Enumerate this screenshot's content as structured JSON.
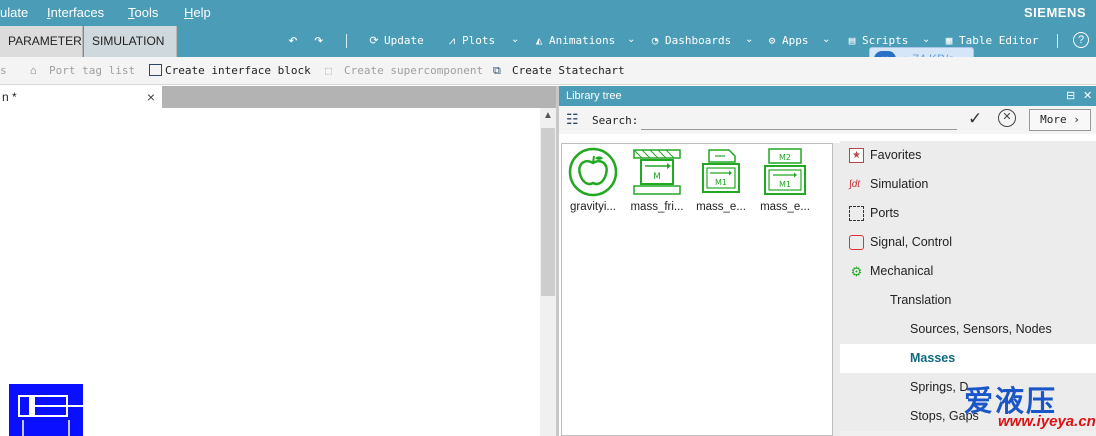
{
  "menu": {
    "items": [
      {
        "label": "ulate",
        "underline": ""
      },
      {
        "label": "nterfaces",
        "underline": "I"
      },
      {
        "label": "ools",
        "underline": "T"
      },
      {
        "label": "elp",
        "underline": "H"
      }
    ],
    "brand": "SIEMENS"
  },
  "tabs": [
    "PARAMETER",
    "SIMULATION"
  ],
  "toolbar": {
    "update": "Update",
    "plots": "Plots",
    "animations": "Animations",
    "dashboards": "Dashboards",
    "apps": "Apps",
    "scripts": "Scripts",
    "table_editor": "Table Editor",
    "help": "?"
  },
  "network": {
    "speed": "74 KB/s"
  },
  "toolbar2": {
    "partial": "s",
    "port_tag_list": "Port tag list",
    "create_interface_block": "Create interface block",
    "create_supercomponent": "Create supercomponent",
    "create_statechart": "Create Statechart"
  },
  "editor": {
    "tab_label": "n *",
    "close": "×"
  },
  "library": {
    "title": "Library tree",
    "search_label": "Search:",
    "search_value": "",
    "more_label": "More",
    "items": [
      {
        "label": "gravityi...",
        "icon": "apple-icon"
      },
      {
        "label": "mass_fri...",
        "icon": "mass-friction-icon"
      },
      {
        "label": "mass_e...",
        "icon": "mass-element-icon"
      },
      {
        "label": "mass_e...",
        "icon": "mass-element-2-icon"
      }
    ],
    "tree": [
      {
        "label": "Favorites",
        "level": 0,
        "icon": "star-icon"
      },
      {
        "label": "Simulation",
        "level": 0,
        "icon": "integral-icon"
      },
      {
        "label": "Ports",
        "level": 0,
        "icon": "ports-icon"
      },
      {
        "label": "Signal, Control",
        "level": 0,
        "icon": "signal-icon"
      },
      {
        "label": "Mechanical",
        "level": 0,
        "icon": "mechanical-icon"
      },
      {
        "label": "Translation",
        "level": 1
      },
      {
        "label": "Sources, Sensors, Nodes",
        "level": 2
      },
      {
        "label": "Masses",
        "level": 2,
        "selected": true
      },
      {
        "label": "Springs, D",
        "level": 2
      },
      {
        "label": "Stops, Gaps",
        "level": 2
      }
    ]
  },
  "watermark": {
    "text": "爱液压",
    "url": "www.iyeya.cn"
  },
  "colors": {
    "accent": "#4a9cb7",
    "block": "#0a10ff",
    "selected_text": "#0f6a80",
    "icon_green": "#22a822"
  }
}
